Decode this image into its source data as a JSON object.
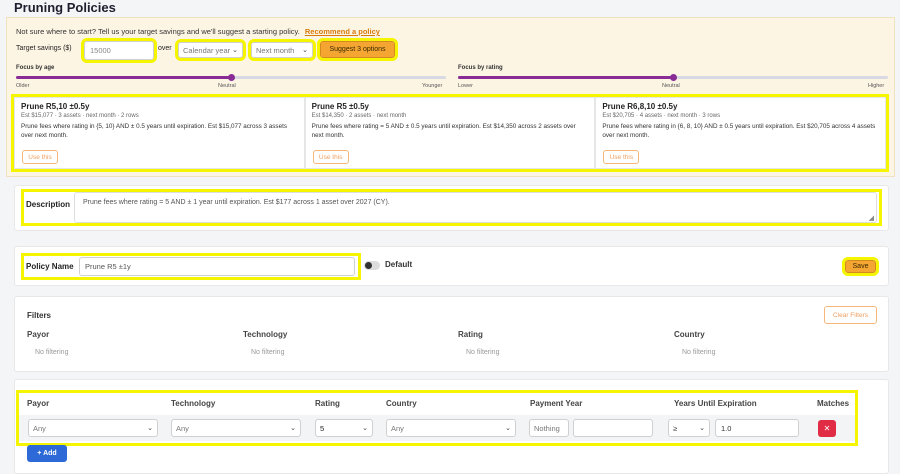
{
  "page_title": "Pruning Policies",
  "suggest": {
    "intro_text": "Not sure where to start? Tell us your target savings and we'll suggest a starting policy.",
    "recommend_link": "Recommend a policy",
    "target_label": "Target savings ($)",
    "target_value": "15000",
    "over_label": "over",
    "period_value": "Calendar year",
    "window_value": "Next month",
    "suggest_button": "Suggest 3 options"
  },
  "sliders": {
    "age": {
      "title": "Focus by age",
      "left": "Older",
      "center": "Neutral",
      "right": "Younger",
      "level": 0.5
    },
    "rating": {
      "title": "Focus by rating",
      "left": "Lower",
      "center": "Neutral",
      "right": "Higher",
      "level": 0.5
    }
  },
  "options": [
    {
      "title": "Prune R5,10 ±0.5y",
      "meta": "Est $15,077 · 3 assets · next month · 2 rows",
      "desc": "Prune fees where rating in {5, 10} AND ± 0.5 years until expiration. Est $15,077 across 3 assets over next month.",
      "button": "Use this"
    },
    {
      "title": "Prune R5 ±0.5y",
      "meta": "Est $14,350 · 2 assets · next month",
      "desc": "Prune fees where rating = 5 AND ± 0.5 years until expiration. Est $14,350 across 2 assets over next month.",
      "button": "Use this"
    },
    {
      "title": "Prune R6,8,10 ±0.5y",
      "meta": "Est $20,705 · 4 assets · next month · 3 rows",
      "desc": "Prune fees where rating in {6, 8, 10} AND ± 0.5 years until expiration. Est $20,705 across 4 assets over next month.",
      "button": "Use this"
    }
  ],
  "description": {
    "label": "Description",
    "value": "Prune fees where rating = 5 AND ± 1 year until expiration. Est $177 across 1 asset over 2027 (CY)."
  },
  "policy": {
    "name_label": "Policy Name",
    "name_value": "Prune R5 ±1y",
    "default_label": "Default",
    "save_button": "Save"
  },
  "filters": {
    "heading": "Filters",
    "clear_button": "Clear Filters",
    "columns": [
      {
        "label": "Payor",
        "value": "No filtering"
      },
      {
        "label": "Technology",
        "value": "No filtering"
      },
      {
        "label": "Rating",
        "value": "No filtering"
      },
      {
        "label": "Country",
        "value": "No filtering"
      }
    ]
  },
  "rules": {
    "headers": {
      "payor": "Payor",
      "technology": "Technology",
      "rating": "Rating",
      "country": "Country",
      "payment_year": "Payment Year",
      "years_until_expiration": "Years Until Expiration",
      "matches": "Matches"
    },
    "row": {
      "payor": "Any",
      "technology": "Any",
      "rating": "5",
      "country": "Any",
      "payment_year_mode": "Nothing",
      "payment_year_value": "",
      "operator": "≥",
      "years_value": "1.0",
      "delete": "✕"
    },
    "add_button": "+ Add"
  },
  "colors": {
    "accent": "#f5a532",
    "purple": "#8a2c96",
    "highlight": "#f5f500",
    "danger": "#e02d45",
    "primary": "#2d6ad8"
  }
}
